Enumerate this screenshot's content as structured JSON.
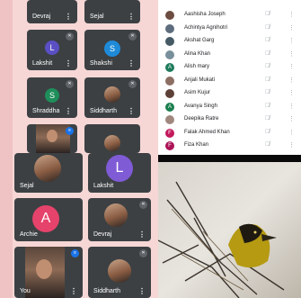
{
  "tiles_top": [
    {
      "name": "Devraj",
      "menu": "⋮"
    },
    {
      "name": "Sejal",
      "menu": "⋮"
    }
  ],
  "tiles_left": [
    {
      "name": "Lakshit",
      "initial": "L",
      "color": "#5b4fc4",
      "menu": "⋮"
    },
    {
      "name": "Shakshi",
      "initial": "S",
      "color": "#1f8ad8",
      "menu": "⋮"
    },
    {
      "name": "Shraddha",
      "initial": "S",
      "color": "#1e8e5a",
      "menu": "⋮"
    },
    {
      "name": "Siddharth",
      "menu": "⋮"
    },
    {
      "name": "Sejal",
      "menu": "⋮"
    },
    {
      "name": "Lakshit",
      "initial": "L",
      "color": "#7f5bd6",
      "menu": "⋮"
    },
    {
      "name": "Archie",
      "initial": "A",
      "color": "#e5436b",
      "menu": "⋮"
    },
    {
      "name": "Devraj",
      "menu": "⋮"
    },
    {
      "name": "You",
      "menu": "⋮"
    },
    {
      "name": "Siddharth",
      "menu": "⋮"
    }
  ],
  "participants": [
    {
      "name": "Aashisha Joseph",
      "initial": "",
      "color": "#6d4c41"
    },
    {
      "name": "Achintya Agnihotri",
      "initial": "",
      "color": "#5d6d7e"
    },
    {
      "name": "Akshat Garg",
      "initial": "",
      "color": "#455a64"
    },
    {
      "name": "Alina Khan",
      "initial": "",
      "color": "#78909c"
    },
    {
      "name": "Alish mary",
      "initial": "A",
      "color": "#1e7b5c"
    },
    {
      "name": "Anjali Mukati",
      "initial": "",
      "color": "#8d6e63"
    },
    {
      "name": "Asim Kujur",
      "initial": "",
      "color": "#5d4037"
    },
    {
      "name": "Avanya Singh",
      "initial": "A",
      "color": "#1b7f4f"
    },
    {
      "name": "Deepika Ratre",
      "initial": "",
      "color": "#a1887f"
    },
    {
      "name": "Falak Ahmed Khan",
      "initial": "F",
      "color": "#c2185b"
    },
    {
      "name": "Fiza Khan",
      "initial": "F",
      "color": "#ad1457"
    }
  ],
  "icons": {
    "mic_off": "mic-off-icon",
    "more": "more-vert-icon"
  },
  "row_mic": "🎙̸",
  "row_menu": "⋮"
}
